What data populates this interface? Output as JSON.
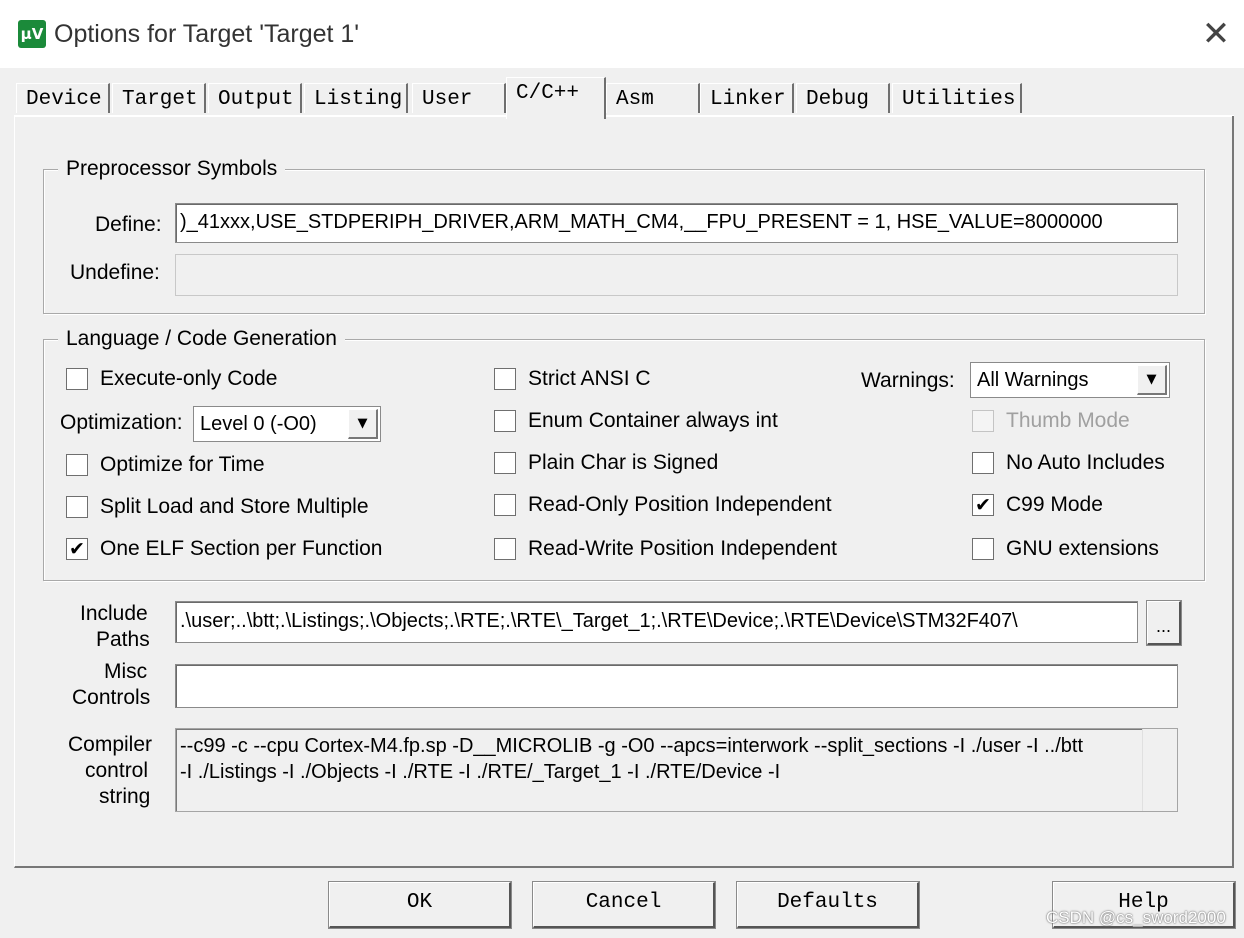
{
  "window": {
    "title": "Options for Target 'Target 1'",
    "icon_text": "µV",
    "close_glyph": "✕"
  },
  "tabs": [
    {
      "label": "Device"
    },
    {
      "label": "Target"
    },
    {
      "label": "Output"
    },
    {
      "label": "Listing"
    },
    {
      "label": "User"
    },
    {
      "label": "C/C++",
      "active": true
    },
    {
      "label": "Asm"
    },
    {
      "label": "Linker"
    },
    {
      "label": "Debug"
    },
    {
      "label": "Utilities"
    }
  ],
  "preprocessor": {
    "legend": "Preprocessor Symbols",
    "define_label": "Define:",
    "define_value": ")_41xxx,USE_STDPERIPH_DRIVER,ARM_MATH_CM4,__FPU_PRESENT = 1, HSE_VALUE=8000000",
    "undefine_label": "Undefine:",
    "undefine_value": ""
  },
  "language": {
    "legend": "Language / Code Generation",
    "execute_only": {
      "label": "Execute-only Code",
      "checked": false
    },
    "optimization_label": "Optimization:",
    "optimization_value": "Level 0 (-O0)",
    "optimize_time": {
      "label": "Optimize for Time",
      "checked": false
    },
    "split_load": {
      "label": "Split Load and Store Multiple",
      "checked": false
    },
    "one_elf": {
      "label": "One ELF Section per Function",
      "checked": true
    },
    "strict_ansi": {
      "label": "Strict ANSI C",
      "checked": false
    },
    "enum_int": {
      "label": "Enum Container always int",
      "checked": false
    },
    "plain_char": {
      "label": "Plain Char is Signed",
      "checked": false
    },
    "ro_pi": {
      "label": "Read-Only Position Independent",
      "checked": false
    },
    "rw_pi": {
      "label": "Read-Write Position Independent",
      "checked": false
    },
    "warnings_label": "Warnings:",
    "warnings_value": "All Warnings",
    "thumb_mode": {
      "label": "Thumb Mode",
      "checked": false,
      "disabled": true
    },
    "no_auto_includes": {
      "label": "No Auto Includes",
      "checked": false
    },
    "c99_mode": {
      "label": "C99 Mode",
      "checked": true
    },
    "gnu_ext": {
      "label": "GNU extensions",
      "checked": false
    }
  },
  "include": {
    "label_line1": "Include",
    "label_line2": "Paths",
    "value": ".\\user;..\\btt;.\\Listings;.\\Objects;.\\RTE;.\\RTE\\_Target_1;.\\RTE\\Device;.\\RTE\\Device\\STM32F407\\",
    "browse_label": "..."
  },
  "misc": {
    "label_line1": "Misc",
    "label_line2": "Controls",
    "value": ""
  },
  "compiler": {
    "label_line1": "Compiler",
    "label_line2": "control",
    "label_line3": "string",
    "line1": "--c99 -c --cpu Cortex-M4.fp.sp -D__MICROLIB -g -O0 --apcs=interwork --split_sections -I ./user -I ../btt",
    "line2": "-I ./Listings -I ./Objects -I ./RTE -I ./RTE/_Target_1 -I ./RTE/Device -I"
  },
  "buttons": {
    "ok": "OK",
    "cancel": "Cancel",
    "defaults": "Defaults",
    "help": "Help"
  },
  "watermark": "CSDN @cs_sword2000",
  "symbols": {
    "check": "✔",
    "dropdown": "▼"
  }
}
